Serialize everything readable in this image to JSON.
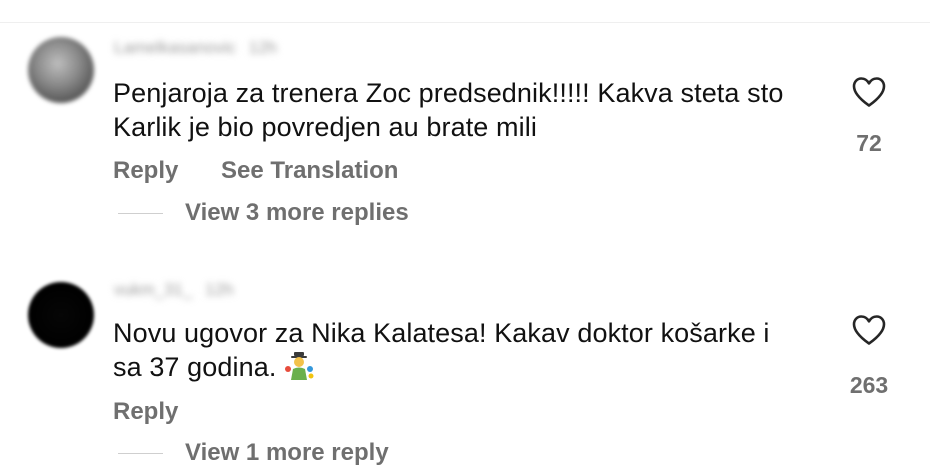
{
  "comments": [
    {
      "username": "Lamelkasanovic",
      "time": "12h",
      "text": "Penjaroja za trenera Zoc predsednik!!!!! Kakva steta sto Karlik je bio povredjen au brate mili",
      "reply_label": "Reply",
      "translate_label": "See Translation",
      "view_replies_label": "View 3 more replies",
      "likes": "72",
      "avatar_icon": "profile-photo-blurred"
    },
    {
      "username": "vukm_31_",
      "time": "12h",
      "text": "Novu ugovor za Nika Kalatesa! Kakav doktor košarke i sa 37 godina.",
      "reply_label": "Reply",
      "view_replies_label": "View 1 more reply",
      "likes": "263",
      "avatar_icon": "profile-photo-black",
      "trailing_emoji": "juggler-emoji"
    }
  ],
  "icons": {
    "like": "heart-outline-icon"
  },
  "colors": {
    "text": "#111111",
    "secondary": "#6f6f6f",
    "heart": "#262626"
  }
}
